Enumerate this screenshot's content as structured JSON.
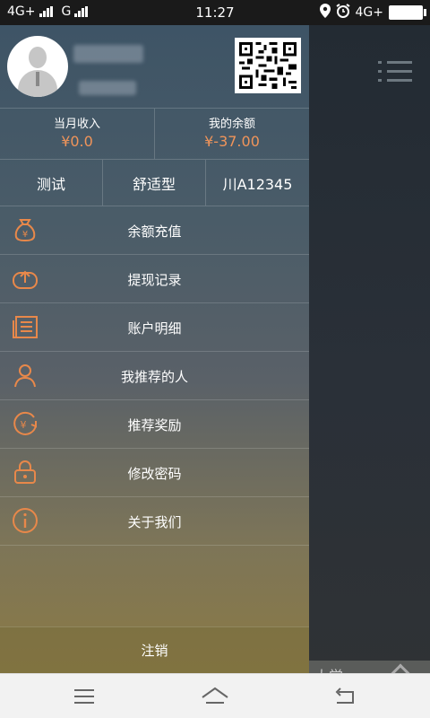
{
  "status_bar": {
    "left_network_1": "4G+",
    "left_network_2": "G",
    "time": "11:27",
    "right_network": "4G+"
  },
  "drawer": {
    "stats": {
      "monthly_income_label": "当月收入",
      "monthly_income_value": "¥0.0",
      "balance_label": "我的余额",
      "balance_value": "¥-37.00"
    },
    "car": {
      "name": "测试",
      "type": "舒适型",
      "plate": "川A12345"
    },
    "menu": [
      {
        "label": "余额充值",
        "icon": "money-bag-icon"
      },
      {
        "label": "提现记录",
        "icon": "upload-icon"
      },
      {
        "label": "账户明细",
        "icon": "ledger-icon"
      },
      {
        "label": "我推荐的人",
        "icon": "person-icon"
      },
      {
        "label": "推荐奖励",
        "icon": "reward-icon"
      },
      {
        "label": "修改密码",
        "icon": "lock-icon"
      },
      {
        "label": "关于我们",
        "icon": "info-icon"
      }
    ],
    "logout_label": "注销"
  },
  "map": {
    "label": "大学"
  },
  "colors": {
    "accent": "#f0945a",
    "icon": "#e8884a"
  }
}
